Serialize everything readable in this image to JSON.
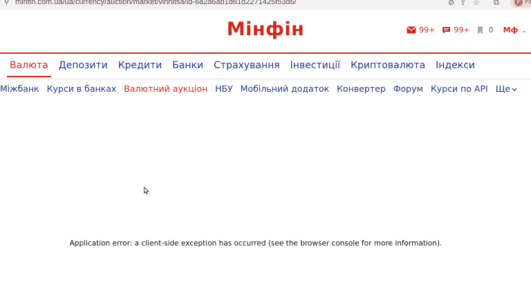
{
  "browser": {
    "url": "minfin.com.ua/ua/currency/auction/market/vinnitsa/id-6a2a6ab1d61d2271425f53d6/",
    "profile_initial": "Р",
    "profile_label": "Ра"
  },
  "site": {
    "logo": "Мінфін",
    "header_actions": {
      "messages_count": "99+",
      "comments_count": "99+",
      "bookmarks_count": "0",
      "account_label": "Мф"
    }
  },
  "main_nav": [
    {
      "label": "Валюта",
      "active": true
    },
    {
      "label": "Депозити",
      "active": false
    },
    {
      "label": "Кредити",
      "active": false
    },
    {
      "label": "Банки",
      "active": false
    },
    {
      "label": "Страхування",
      "active": false
    },
    {
      "label": "Інвестиції",
      "active": false
    },
    {
      "label": "Криптовалюта",
      "active": false
    },
    {
      "label": "Індекси",
      "active": false
    }
  ],
  "sub_nav": [
    {
      "label": "Міжбанк",
      "active": false
    },
    {
      "label": "Курси в банках",
      "active": false
    },
    {
      "label": "Валютний аукціон",
      "active": true
    },
    {
      "label": "НБУ",
      "active": false
    },
    {
      "label": "Мобільний додаток",
      "active": false
    },
    {
      "label": "Конвертер",
      "active": false
    },
    {
      "label": "Форум",
      "active": false
    },
    {
      "label": "Курси по API",
      "active": false
    },
    {
      "label": "Ще",
      "active": false
    }
  ],
  "error_message": "Application error: a client-side exception has occurred (see the browser console for more information).",
  "colors": {
    "brand": "#d4271e",
    "link": "#1d3a8a"
  }
}
